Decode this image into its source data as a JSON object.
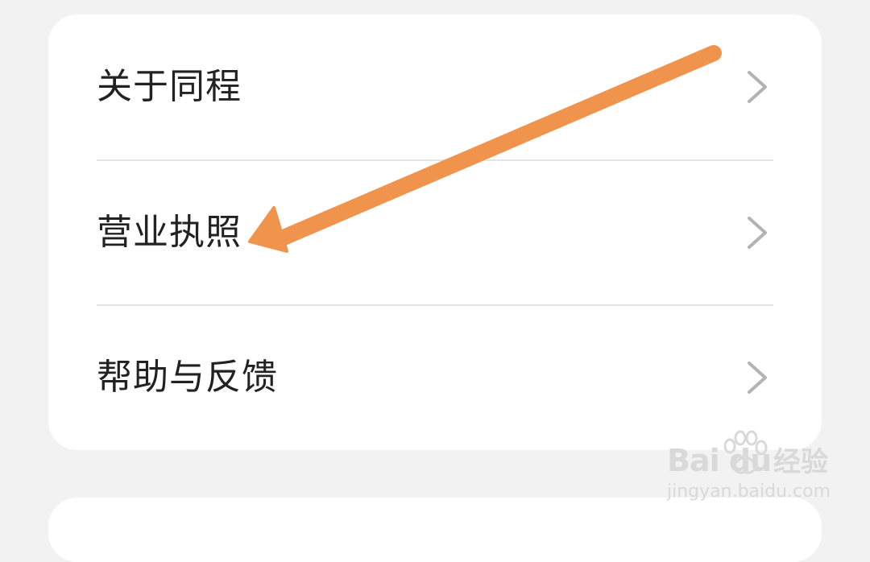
{
  "settings_menu": {
    "items": [
      {
        "label": "关于同程",
        "icon": "chevron-right-icon"
      },
      {
        "label": "营业执照",
        "icon": "chevron-right-icon"
      },
      {
        "label": "帮助与反馈",
        "icon": "chevron-right-icon"
      }
    ]
  },
  "annotation": {
    "type": "arrow",
    "target": "营业执照",
    "color": "#f0944d"
  },
  "watermark": {
    "logo_text": "Bai  du",
    "jingyan_text": "经验",
    "url_text": "jingyan.baidu.com"
  },
  "colors": {
    "background": "#f2f2f2",
    "card": "#ffffff",
    "text": "#222222",
    "chevron": "#b3b3b3",
    "divider": "#e4e4e4"
  }
}
